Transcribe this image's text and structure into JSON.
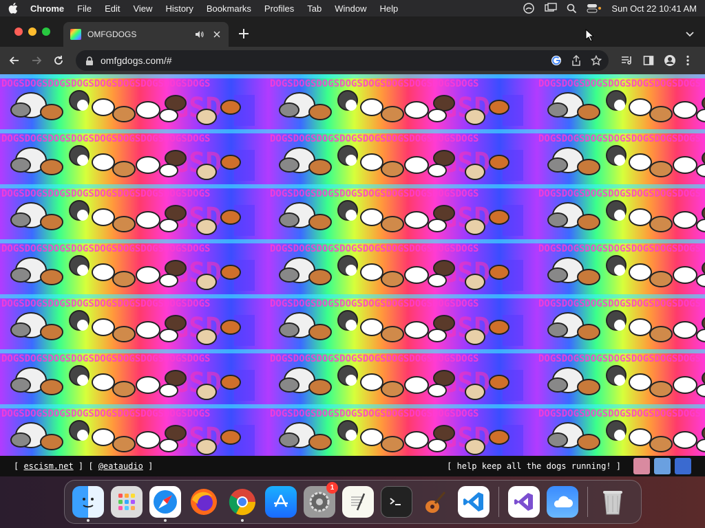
{
  "menubar": {
    "app_name": "Chrome",
    "items": [
      "File",
      "Edit",
      "View",
      "History",
      "Bookmarks",
      "Profiles",
      "Tab",
      "Window",
      "Help"
    ],
    "datetime": "Sun Oct 22  10:41 AM"
  },
  "tab": {
    "title": "OMFGDOGS"
  },
  "omnibox": {
    "url": "omfgdogs.com/#"
  },
  "footer": {
    "link1": "escism.net",
    "link2": "@eataudio",
    "message": "[ help keep all the dogs running! ]"
  },
  "dock": {
    "settings_badge": "1"
  },
  "colors": {
    "close": "#ff5f57",
    "minimize": "#febc2e",
    "maximize": "#28c840"
  }
}
